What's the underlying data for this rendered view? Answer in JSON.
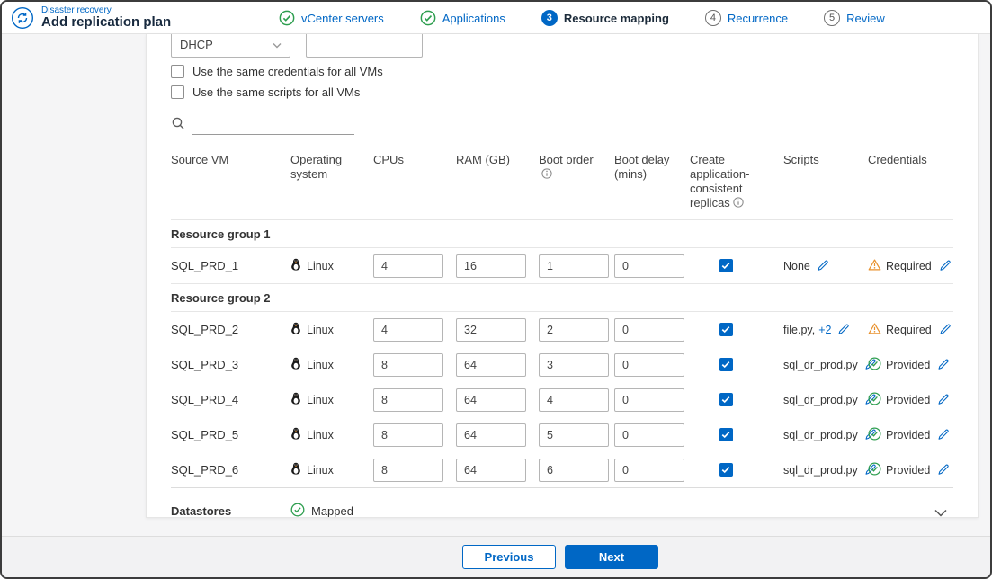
{
  "colors": {
    "accent": "#0067C5",
    "success": "#2e9e4f",
    "warning": "#E8912D"
  },
  "icons": {
    "brand": "disaster-recovery-circular-arrows",
    "done_step": "check-circle",
    "search": "magnifier",
    "os_linux": "penguin",
    "edit": "pencil",
    "warning": "triangle-exclamation",
    "success": "check-circle",
    "info": "i-circle",
    "collapse": "chevron-down",
    "dropdown": "caret-down"
  },
  "header": {
    "service": "Disaster recovery",
    "title": "Add replication plan",
    "steps": [
      {
        "label": "vCenter servers",
        "state": "done"
      },
      {
        "label": "Applications",
        "state": "done"
      },
      {
        "label": "Resource mapping",
        "state": "active",
        "number": "3"
      },
      {
        "label": "Recurrence",
        "state": "upcoming",
        "number": "4"
      },
      {
        "label": "Review",
        "state": "upcoming",
        "number": "5"
      }
    ]
  },
  "form": {
    "ip_select_value": "DHCP",
    "ip_field_value": "",
    "same_credentials_label": "Use the same credentials for all VMs",
    "same_scripts_label": "Use the same scripts for all VMs",
    "search_value": ""
  },
  "table": {
    "headers": {
      "source_vm": "Source VM",
      "os": "Operating system",
      "cpus": "CPUs",
      "ram": "RAM (GB)",
      "boot_order": "Boot order",
      "boot_delay": "Boot delay (mins)",
      "consistent": "Create application-consistent replicas",
      "scripts": "Scripts",
      "credentials": "Credentials"
    },
    "groups": [
      {
        "name": "Resource group 1",
        "rows": [
          {
            "vm": "SQL_PRD_1",
            "os": "Linux",
            "cpus": "4",
            "ram": "16",
            "boot_order": "1",
            "boot_delay": "0",
            "consistent": true,
            "scripts": "None",
            "scripts_extra": "",
            "credentials": "Required",
            "credentials_state": "required"
          }
        ]
      },
      {
        "name": "Resource group 2",
        "rows": [
          {
            "vm": "SQL_PRD_2",
            "os": "Linux",
            "cpus": "4",
            "ram": "32",
            "boot_order": "2",
            "boot_delay": "0",
            "consistent": true,
            "scripts": "file.py,",
            "scripts_extra": "+2",
            "credentials": "Required",
            "credentials_state": "required"
          },
          {
            "vm": "SQL_PRD_3",
            "os": "Linux",
            "cpus": "8",
            "ram": "64",
            "boot_order": "3",
            "boot_delay": "0",
            "consistent": true,
            "scripts": "sql_dr_prod.py",
            "scripts_extra": "",
            "credentials": "Provided",
            "credentials_state": "provided"
          },
          {
            "vm": "SQL_PRD_4",
            "os": "Linux",
            "cpus": "8",
            "ram": "64",
            "boot_order": "4",
            "boot_delay": "0",
            "consistent": true,
            "scripts": "sql_dr_prod.py",
            "scripts_extra": "",
            "credentials": "Provided",
            "credentials_state": "provided"
          },
          {
            "vm": "SQL_PRD_5",
            "os": "Linux",
            "cpus": "8",
            "ram": "64",
            "boot_order": "5",
            "boot_delay": "0",
            "consistent": true,
            "scripts": "sql_dr_prod.py",
            "scripts_extra": "",
            "credentials": "Provided",
            "credentials_state": "provided"
          },
          {
            "vm": "SQL_PRD_6",
            "os": "Linux",
            "cpus": "8",
            "ram": "64",
            "boot_order": "6",
            "boot_delay": "0",
            "consistent": true,
            "scripts": "sql_dr_prod.py",
            "scripts_extra": "",
            "credentials": "Provided",
            "credentials_state": "provided"
          }
        ]
      }
    ]
  },
  "datastores": {
    "title": "Datastores",
    "status": "Mapped"
  },
  "footer": {
    "previous_label": "Previous",
    "next_label": "Next"
  }
}
